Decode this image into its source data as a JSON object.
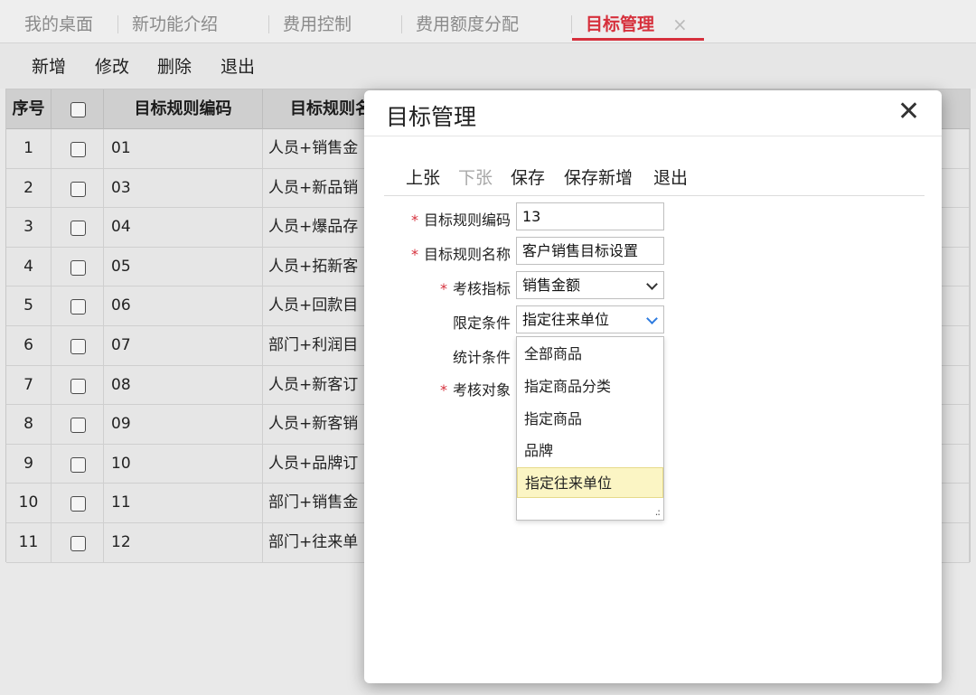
{
  "tabs": [
    {
      "label": "我的桌面",
      "active": false
    },
    {
      "label": "新功能介绍",
      "active": false
    },
    {
      "label": "费用控制",
      "active": false
    },
    {
      "label": "费用额度分配",
      "active": false
    },
    {
      "label": "目标管理",
      "active": true
    }
  ],
  "tab_close_icon": "×",
  "toolbar": {
    "add": "新增",
    "edit": "修改",
    "delete": "删除",
    "exit": "退出"
  },
  "table": {
    "headers": {
      "index": "序号",
      "code": "目标规则编码",
      "name": "目标规则名"
    },
    "rows": [
      {
        "index": "1",
        "code": "01",
        "name": "人员+销售金"
      },
      {
        "index": "2",
        "code": "03",
        "name": "人员+新品销"
      },
      {
        "index": "3",
        "code": "04",
        "name": "人员+爆品存"
      },
      {
        "index": "4",
        "code": "05",
        "name": "人员+拓新客"
      },
      {
        "index": "5",
        "code": "06",
        "name": "人员+回款目"
      },
      {
        "index": "6",
        "code": "07",
        "name": "部门+利润目"
      },
      {
        "index": "7",
        "code": "08",
        "name": "人员+新客订"
      },
      {
        "index": "8",
        "code": "09",
        "name": "人员+新客销"
      },
      {
        "index": "9",
        "code": "10",
        "name": "人员+品牌订"
      },
      {
        "index": "10",
        "code": "11",
        "name": "部门+销售金"
      },
      {
        "index": "11",
        "code": "12",
        "name": "部门+往来单"
      }
    ]
  },
  "modal": {
    "title": "目标管理",
    "close_icon": "✕",
    "buttons": {
      "prev": "上张",
      "next": "下张",
      "save": "保存",
      "save_new": "保存新增",
      "exit": "退出"
    },
    "fields": {
      "rule_code": {
        "label": "目标规则编码",
        "value": "13",
        "required": true
      },
      "rule_name": {
        "label": "目标规则名称",
        "value": "客户销售目标设置",
        "required": true
      },
      "metric": {
        "label": "考核指标",
        "value": "销售金额",
        "required": true
      },
      "limit": {
        "label": "限定条件",
        "value": "指定往来单位",
        "required": false
      },
      "stat": {
        "label": "统计条件",
        "required": false
      },
      "target": {
        "label": "考核对象",
        "required": true
      }
    },
    "required_mark": "*",
    "dropdown_options": [
      "全部商品",
      "指定商品分类",
      "指定商品",
      "品牌",
      "指定往来单位"
    ],
    "dropdown_selected": "指定往来单位",
    "grip_icon": ".:"
  }
}
